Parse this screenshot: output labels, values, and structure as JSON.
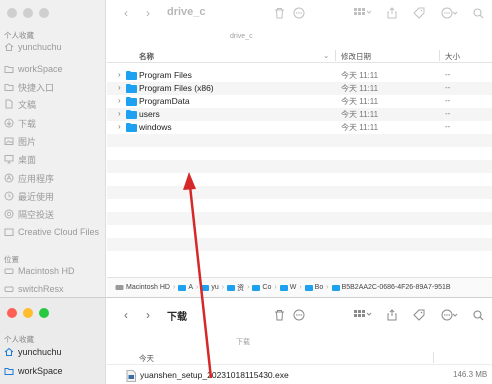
{
  "window1": {
    "title": "drive_c",
    "subtitle": "drive_c",
    "sidebar_section_favorites": "个人收藏",
    "sidebar_section_locations": "位置",
    "sidebar_items": [
      {
        "label": "yunchuchu",
        "icon": "home-icon"
      },
      {
        "label": "workSpace",
        "icon": "folder-icon"
      },
      {
        "label": "快捷入口",
        "icon": "folder-icon"
      },
      {
        "label": "文稿",
        "icon": "document-icon"
      },
      {
        "label": "下载",
        "icon": "download-icon"
      },
      {
        "label": "图片",
        "icon": "image-icon"
      },
      {
        "label": "桌面",
        "icon": "desktop-icon"
      },
      {
        "label": "应用程序",
        "icon": "apps-icon"
      },
      {
        "label": "最近使用",
        "icon": "clock-icon"
      },
      {
        "label": "隔空投送",
        "icon": "airdrop-icon"
      },
      {
        "label": "Creative Cloud Files",
        "icon": "cloud-icon"
      }
    ],
    "location_items": [
      {
        "label": "Macintosh HD",
        "icon": "disk-icon"
      },
      {
        "label": "switchResx",
        "icon": "disk-icon"
      }
    ],
    "columns": {
      "name": "名称",
      "modified": "修改日期",
      "size": "大小"
    },
    "files": [
      {
        "name": "Program Files",
        "date": "今天 11:11",
        "size": "--"
      },
      {
        "name": "Program Files (x86)",
        "date": "今天 11:11",
        "size": "--"
      },
      {
        "name": "ProgramData",
        "date": "今天 11:11",
        "size": "--"
      },
      {
        "name": "users",
        "date": "今天 11:11",
        "size": "--"
      },
      {
        "name": "windows",
        "date": "今天 11:11",
        "size": "--"
      }
    ],
    "pathbar": [
      "Macintosh HD",
      "A",
      "yu",
      "资",
      "Co",
      "W",
      "Bo",
      "B5B2AA2C-0686-4F26-89A7-951B"
    ]
  },
  "window2": {
    "title": "下载",
    "subtitle": "下载",
    "sidebar_section_favorites": "个人收藏",
    "sidebar_items": [
      {
        "label": "yunchuchu",
        "icon": "home-icon"
      },
      {
        "label": "workSpace",
        "icon": "folder-icon"
      }
    ],
    "group_label": "今天",
    "files": [
      {
        "name": "yuanshen_setup_20231018115430.exe",
        "size": "146.3 MB"
      }
    ]
  },
  "colors": {
    "accent_folder": "#1ea1f1",
    "arrow": "#d62828"
  }
}
